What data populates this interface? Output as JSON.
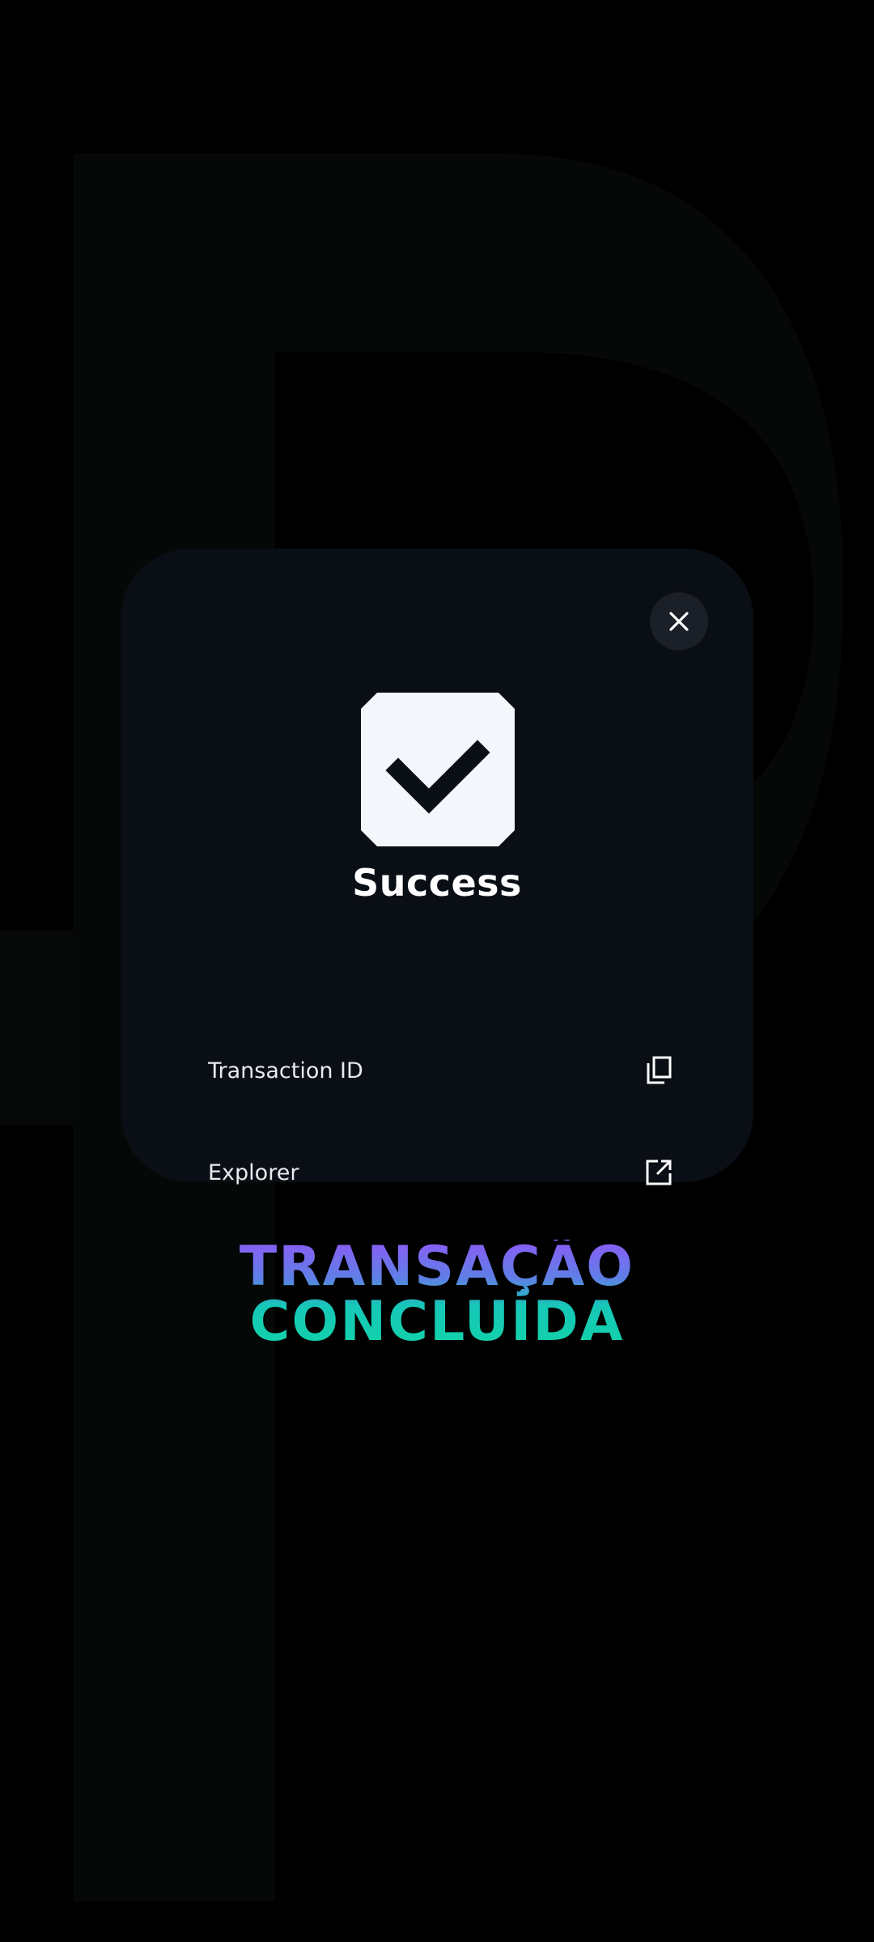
{
  "modal": {
    "title": "Success",
    "rows": [
      {
        "label": "Transaction ID",
        "icon": "copy-icon"
      },
      {
        "label": "Explorer",
        "icon": "external-link-icon"
      }
    ],
    "close_icon": "close-icon"
  },
  "caption": {
    "line1": "TRANSAÇÃO",
    "line2": "CONCLUÍDA"
  },
  "colors": {
    "background": "#000000",
    "modal_background": "#0a0e15",
    "gradient_start": "#8a5cf6",
    "gradient_end": "#11d3a8",
    "text": "#ffffff"
  }
}
